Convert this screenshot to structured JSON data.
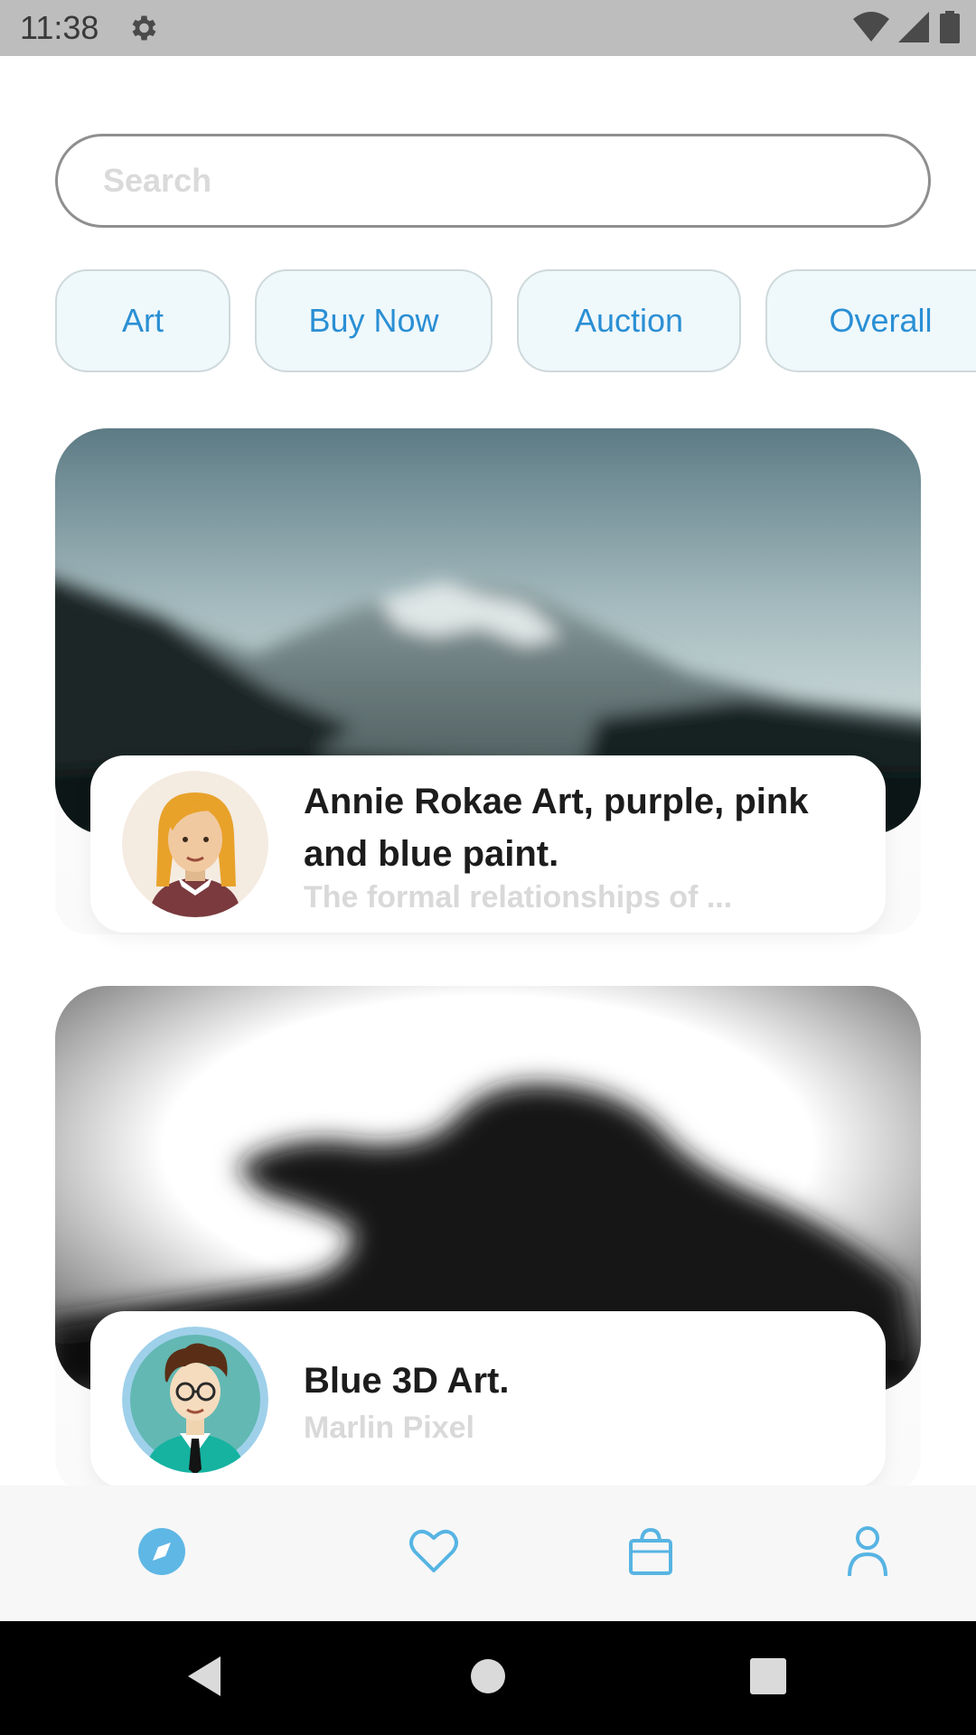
{
  "status_bar": {
    "time": "11:38",
    "icons": [
      "gear-icon",
      "wifi-icon",
      "signal-icon",
      "battery-icon"
    ]
  },
  "search": {
    "placeholder": "Search",
    "value": ""
  },
  "filters": [
    {
      "label": "Art"
    },
    {
      "label": "Buy Now"
    },
    {
      "label": "Auction"
    },
    {
      "label": "Overall"
    }
  ],
  "cards": [
    {
      "title": "Annie Rokae Art, purple, pink and blue paint.",
      "subtitle": "The formal relationships of ...",
      "avatar": "woman-avatar",
      "image": "blurred-mountain"
    },
    {
      "title": "Blue 3D Art.",
      "subtitle": "Marlin Pixel",
      "avatar": "man-avatar",
      "image": "blurred-dark-shape"
    }
  ],
  "bottom_nav": [
    {
      "icon": "compass-icon",
      "active": true
    },
    {
      "icon": "heart-icon",
      "active": false
    },
    {
      "icon": "shopping-bag-icon",
      "active": false
    },
    {
      "icon": "profile-icon",
      "active": false
    }
  ],
  "colors": {
    "accent": "#2a8fd4",
    "active_nav": "#5fb7e5",
    "nav_icon": "#57b4e3",
    "chip_bg": "#eff8fb",
    "subtitle": "#d9d9d9"
  },
  "system_nav": [
    "back-icon",
    "home-icon",
    "recents-icon"
  ]
}
